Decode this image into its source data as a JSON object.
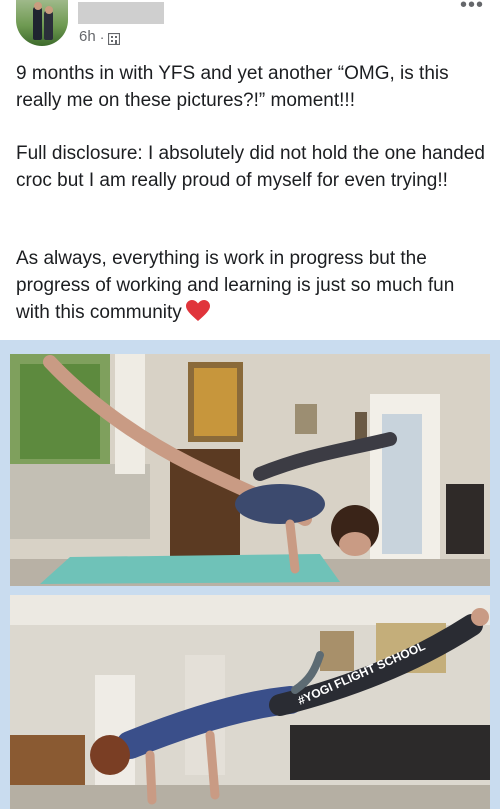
{
  "post": {
    "time": "6h",
    "separator": "·",
    "text_line1": "9 months in with YFS and yet another “OMG, is this really me on these pictures?!” moment!!!",
    "text_line2": "Full disclosure: I absolutely did not hold the one handed croc but I am really proud of myself for even trying!!",
    "text_line3": "As always, everything is work in progress but the progress of working and learning is just so much fun with this community",
    "more_label": "•••"
  },
  "photos": {
    "photo2_leggings_text": "#YOGI FLIGHT SCHOOL"
  },
  "colors": {
    "gallery_bg": "#c9dcef",
    "heart": "#e0343b",
    "meta_gray": "#65676b"
  },
  "icons": [
    "more-options-icon",
    "audience-icon",
    "heart-emoji-icon"
  ]
}
